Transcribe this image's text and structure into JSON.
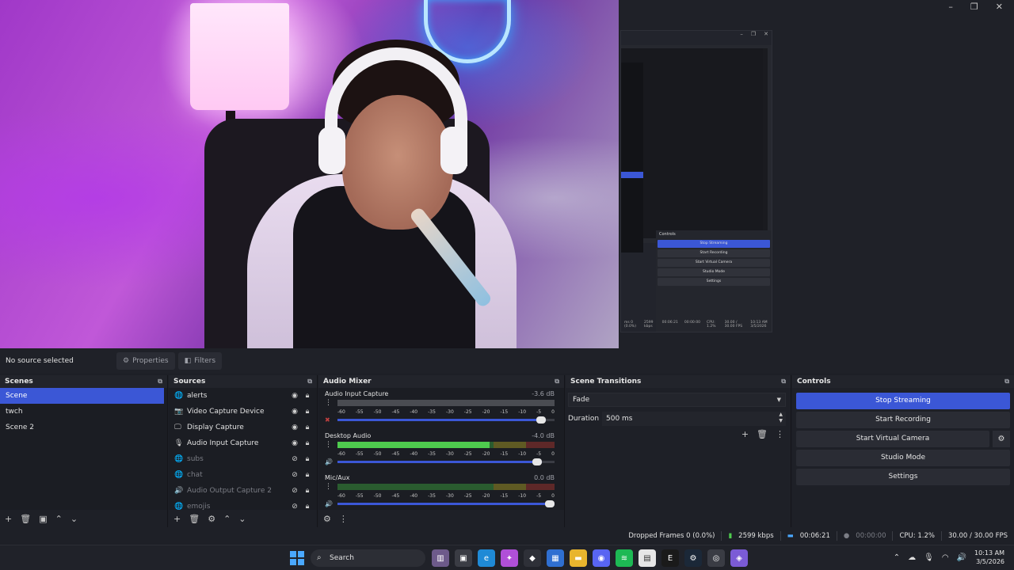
{
  "window": {
    "controls": [
      "–",
      "❐",
      "✕"
    ]
  },
  "mini_window": {
    "controls": [
      "–",
      "❐",
      "✕"
    ],
    "controls_title": "Controls",
    "buttons": [
      "Stop Streaming",
      "Start Recording",
      "Start Virtual Camera",
      "Studio Mode",
      "Settings"
    ],
    "status": [
      "ms 0 (0.0%)",
      "2599 kbps",
      "00:06:21",
      "00:00:00",
      "CPU: 1.2%",
      "30.00 / 30.00 FPS"
    ],
    "clock_time": "10:13 AM",
    "clock_date": "3/5/2026"
  },
  "source_bar": {
    "no_source": "No source selected",
    "properties": "Properties",
    "filters": "Filters"
  },
  "scenes": {
    "title": "Scenes",
    "items": [
      {
        "label": "Scene"
      },
      {
        "label": "twch"
      },
      {
        "label": "Scene 2"
      }
    ],
    "footer": [
      "+",
      "🗑",
      "▣",
      "⌃",
      "⌄"
    ]
  },
  "sources": {
    "title": "Sources",
    "items": [
      {
        "label": "alerts",
        "icon": "globe-icon",
        "glyph": "🌐",
        "visible": true
      },
      {
        "label": "Video Capture Device",
        "icon": "camera-icon",
        "glyph": "📷",
        "visible": true
      },
      {
        "label": "Display Capture",
        "icon": "monitor-icon",
        "glyph": "🖵",
        "visible": true
      },
      {
        "label": "Audio Input Capture",
        "icon": "microphone-icon",
        "glyph": "🎙",
        "visible": true
      },
      {
        "label": "subs",
        "icon": "globe-icon",
        "glyph": "🌐",
        "visible": false
      },
      {
        "label": "chat",
        "icon": "globe-icon",
        "glyph": "🌐",
        "visible": false
      },
      {
        "label": "Audio Output Capture 2",
        "icon": "speaker-icon",
        "glyph": "🔊",
        "visible": false
      },
      {
        "label": "emojis",
        "icon": "globe-icon",
        "glyph": "🌐",
        "visible": false
      }
    ],
    "footer": [
      "+",
      "🗑",
      "⚙",
      "⌃",
      "⌄"
    ]
  },
  "mixer": {
    "title": "Audio Mixer",
    "ticks": [
      "-60",
      "-55",
      "-50",
      "-45",
      "-40",
      "-35",
      "-30",
      "-25",
      "-20",
      "-15",
      "-10",
      "-5",
      "0"
    ],
    "channels": [
      {
        "name": "Audio Input Capture",
        "db": "-3.6 dB",
        "level": 0.0,
        "volume": 0.96,
        "muted": true
      },
      {
        "name": "Desktop Audio",
        "db": "-4.0 dB",
        "level": 0.7,
        "volume": 0.94,
        "muted": false
      },
      {
        "name": "Mic/Aux",
        "db": "0.0 dB",
        "level": 0.0,
        "volume": 1.0,
        "muted": false
      }
    ]
  },
  "transitions": {
    "title": "Scene Transitions",
    "selected": "Fade",
    "duration_label": "Duration",
    "duration_value": "500 ms"
  },
  "controls": {
    "title": "Controls",
    "buttons": [
      {
        "label": "Stop Streaming",
        "active": true
      },
      {
        "label": "Start Recording",
        "active": false
      },
      {
        "label": "Start Virtual Camera",
        "active": false
      },
      {
        "label": "Studio Mode",
        "active": false
      },
      {
        "label": "Settings",
        "active": false
      }
    ]
  },
  "statusbar": {
    "dropped": "Dropped Frames 0 (0.0%)",
    "bitrate": "2599 kbps",
    "stream_time": "00:06:21",
    "rec_time": "00:00:00",
    "cpu": "CPU: 1.2%",
    "fps": "30.00 / 30.00 FPS"
  },
  "taskbar": {
    "search": "Search",
    "clock_time": "10:13 AM",
    "clock_date": "3/5/2026",
    "apps": [
      {
        "name": "widgets-icon",
        "color": "#6d5a8a",
        "glyph": "▥"
      },
      {
        "name": "task-view-icon",
        "color": "#3a3c44",
        "glyph": "▣"
      },
      {
        "name": "edge-icon",
        "color": "#1f8ad6",
        "glyph": "e"
      },
      {
        "name": "copilot-icon",
        "color": "#b04fd8",
        "glyph": "✦"
      },
      {
        "name": "alienware-icon",
        "color": "#2e3038",
        "glyph": "◆"
      },
      {
        "name": "store-icon",
        "color": "#2f6fd1",
        "glyph": "▦"
      },
      {
        "name": "file-explorer-icon",
        "color": "#e8b52e",
        "glyph": "▬"
      },
      {
        "name": "discord-icon",
        "color": "#5865f2",
        "glyph": "◉"
      },
      {
        "name": "spotify-icon",
        "color": "#1db954",
        "glyph": "≋"
      },
      {
        "name": "notepad-icon",
        "color": "#e6e6e6",
        "glyph": "▤"
      },
      {
        "name": "epic-games-icon",
        "color": "#1a1a1a",
        "glyph": "E"
      },
      {
        "name": "steam-icon",
        "color": "#1b2838",
        "glyph": "⚙"
      },
      {
        "name": "obs-icon",
        "color": "#3a3c44",
        "glyph": "◎"
      },
      {
        "name": "twitch-app-icon",
        "color": "#7b5bd6",
        "glyph": "◈"
      }
    ]
  }
}
